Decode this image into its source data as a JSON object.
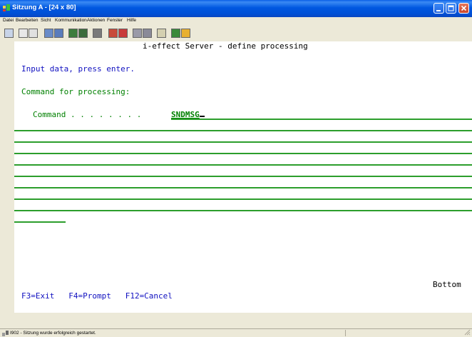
{
  "window": {
    "title": "Sitzung A - [24 x 80]",
    "accent": "#0058e0"
  },
  "menu": {
    "items": [
      "Datei",
      "Bearbeiten",
      "Sicht",
      "Kommunikation",
      "Aktionen",
      "Fenster",
      "Hilfe"
    ]
  },
  "toolbar": {
    "icons": [
      "print-screen-icon",
      "copy-icon",
      "paste-icon",
      "send-icon",
      "receive-icon",
      "display-icon",
      "keyboard-icon",
      "macro-icon",
      "record-icon",
      "play-icon",
      "stop-icon",
      "client-access-icon",
      "help-icon",
      "settings-icon"
    ]
  },
  "terminal": {
    "title": "i-effect Server - define processing",
    "instruction": "Input data, press enter.",
    "section": "Command for processing:",
    "command_label": "Command . . . . . . . .",
    "command_value": "SNDMSG",
    "bottom_label": "Bottom",
    "fkeys": "F3=Exit   F4=Prompt   F12=Cancel",
    "colors": {
      "text_blue": "#1010c0",
      "field_green": "#008000",
      "underline_green": "#2c9e2c"
    }
  },
  "statusbar": {
    "text": "I902 - Sitzung wurde erfolgreich gestartet."
  }
}
